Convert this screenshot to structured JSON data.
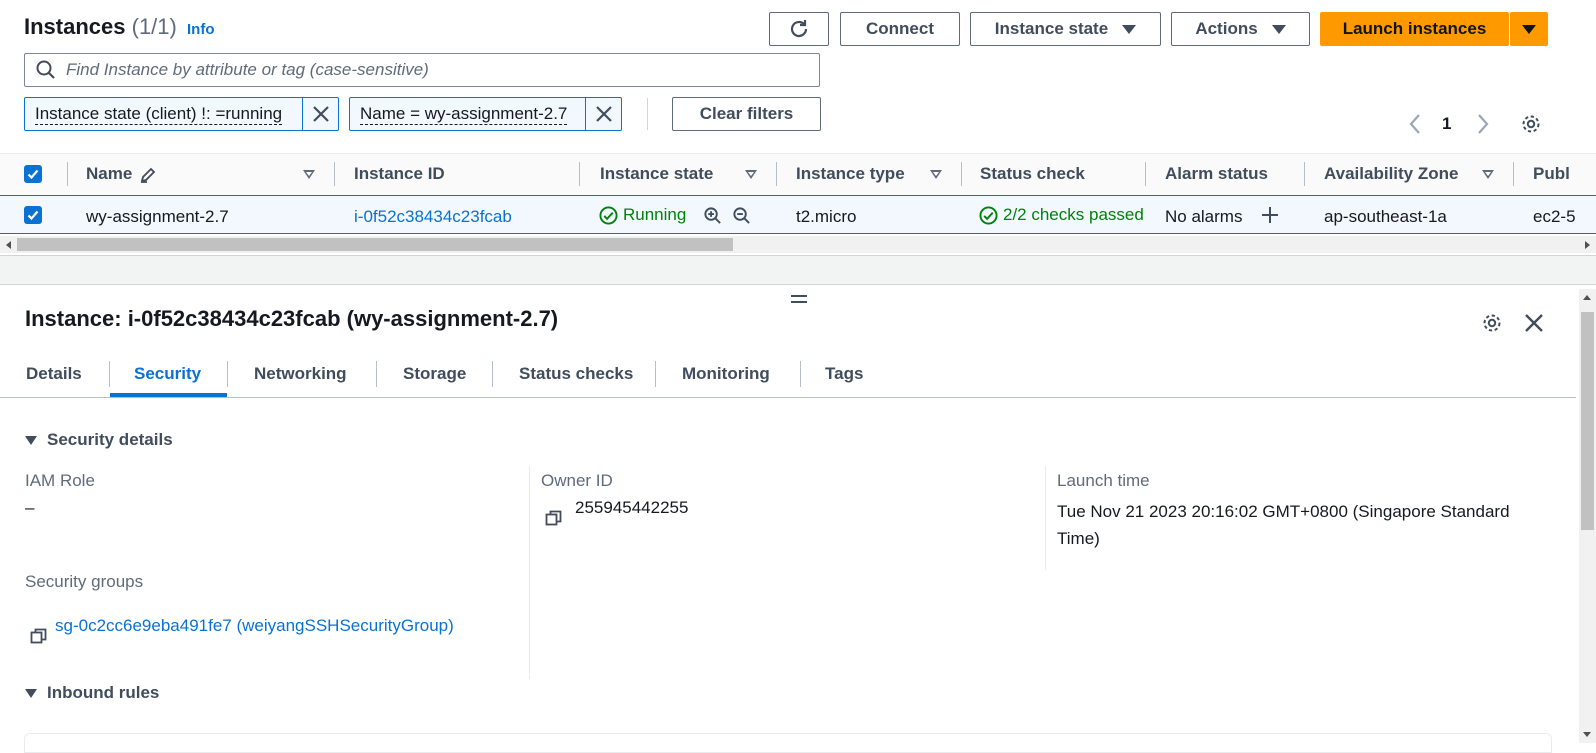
{
  "header": {
    "title": "Instances",
    "count": "(1/1)",
    "info": "Info",
    "buttons": {
      "connect": "Connect",
      "instance_state": "Instance state",
      "actions": "Actions",
      "launch": "Launch instances"
    },
    "search_placeholder": "Find Instance by attribute or tag (case-sensitive)",
    "filters": [
      "Instance state (client) !: =running",
      "Name = wy-assignment-2.7"
    ],
    "clear_filters": "Clear filters",
    "page_number": "1",
    "colors": {
      "accent": "#0972d3",
      "launch": "#ff9900",
      "running": "#037f0c"
    }
  },
  "table": {
    "columns": [
      "Name",
      "Instance ID",
      "Instance state",
      "Instance type",
      "Status check",
      "Alarm status",
      "Availability Zone",
      "Publ"
    ],
    "row": {
      "name": "wy-assignment-2.7",
      "instance_id": "i-0f52c38434c23fcab",
      "state": "Running",
      "type": "t2.micro",
      "status_check": "2/2 checks passed",
      "alarm": "No alarms",
      "az": "ap-southeast-1a",
      "public": "ec2-5"
    }
  },
  "details": {
    "title": "Instance: i-0f52c38434c23fcab (wy-assignment-2.7)",
    "tabs": [
      "Details",
      "Security",
      "Networking",
      "Storage",
      "Status checks",
      "Monitoring",
      "Tags"
    ],
    "active_tab": "Security",
    "security_section": "Security details",
    "iam_role_label": "IAM Role",
    "iam_role_value": "–",
    "owner_id_label": "Owner ID",
    "owner_id_value": "255945442255",
    "launch_time_label": "Launch time",
    "launch_time_line1": "Tue Nov 21 2023 20:16:02 GMT+0800 (Singapore Standard",
    "launch_time_line2": "Time)",
    "security_groups_label": "Security groups",
    "security_group_value": "sg-0c2cc6e9eba491fe7 (weiyangSSHSecurityGroup)",
    "inbound_section": "Inbound rules"
  }
}
